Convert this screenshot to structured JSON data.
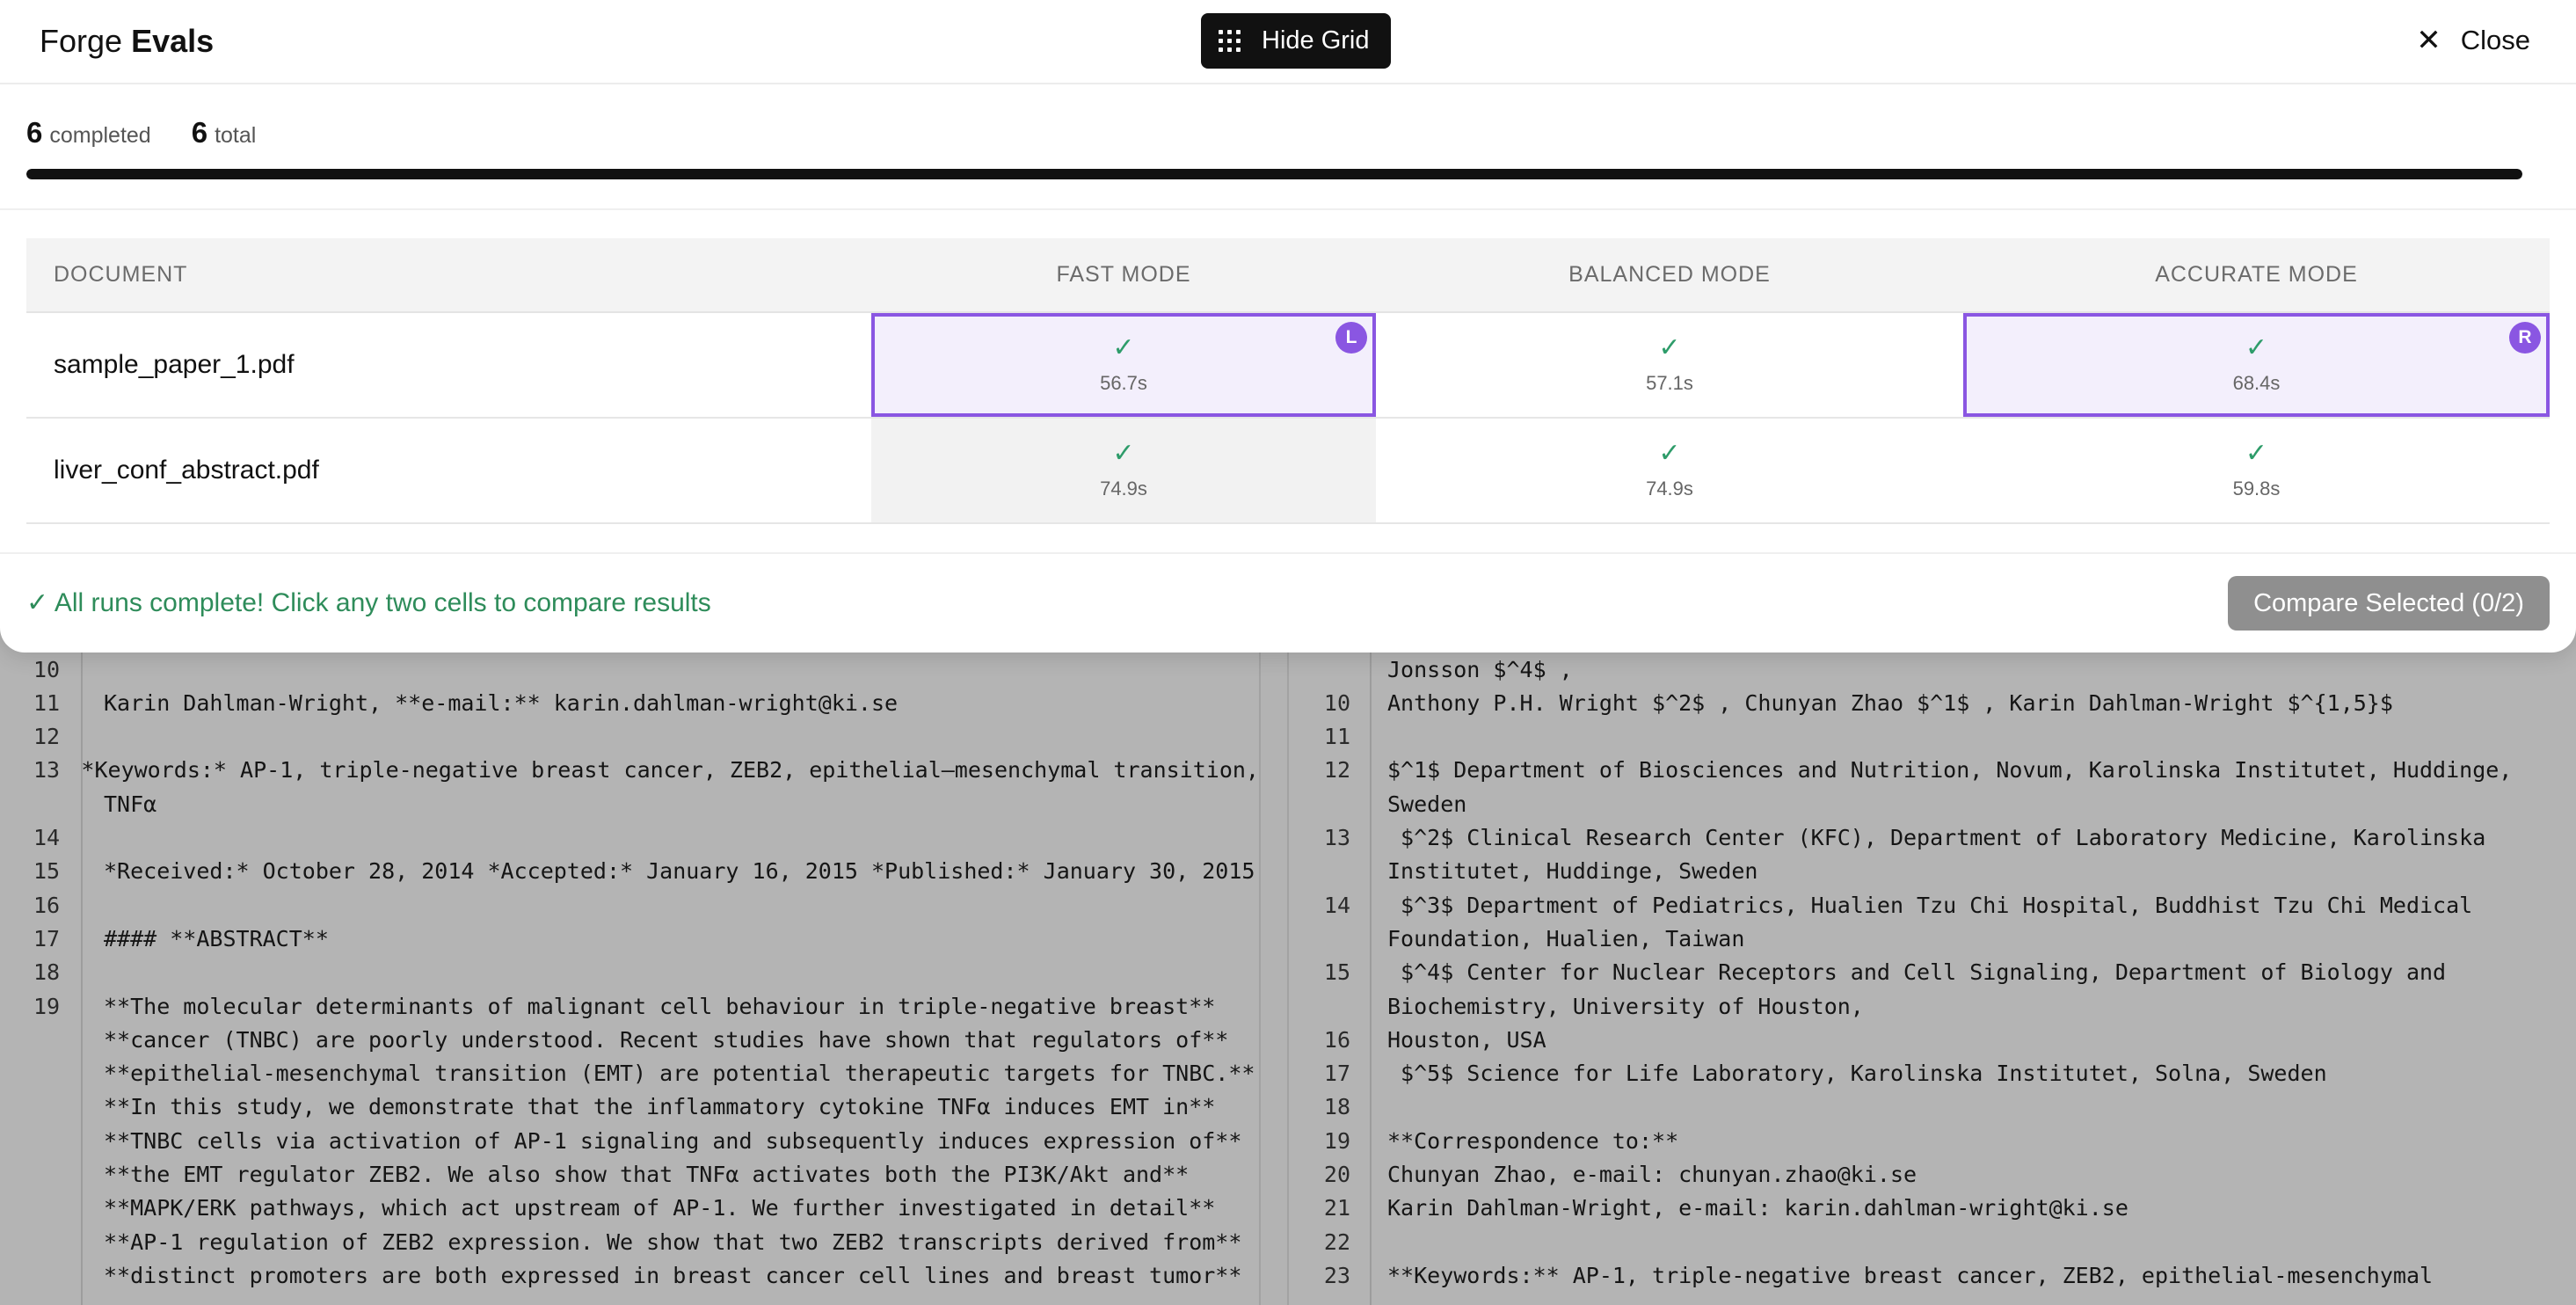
{
  "app": {
    "brand_light": "Forge",
    "brand_bold": "Evals"
  },
  "header": {
    "hide_grid_label": "Hide Grid",
    "close_label": "Close",
    "grid_icon": "grid-dots-icon",
    "close_icon": "close-icon"
  },
  "stats": {
    "completed_value": "6",
    "completed_label": "completed",
    "total_value": "6",
    "total_label": "total",
    "progress_fraction": 1.0
  },
  "table": {
    "headers": {
      "document": "DOCUMENT",
      "fast": "FAST MODE",
      "balanced": "BALANCED MODE",
      "accurate": "ACCURATE MODE"
    },
    "rows": [
      {
        "document": "sample_paper_1.pdf",
        "fast": "56.7s",
        "balanced": "57.1s",
        "accurate": "68.4s",
        "fast_badge": "L",
        "accurate_badge": "R"
      },
      {
        "document": "liver_conf_abstract.pdf",
        "fast": "74.9s",
        "balanced": "74.9s",
        "accurate": "59.8s"
      }
    ],
    "check_glyph": "✓"
  },
  "footer": {
    "status": "✓ All runs complete! Click any two cells to compare results",
    "compare_label": "Compare Selected (0/2)"
  },
  "diff": {
    "left": [
      {
        "n": "10",
        "t": ""
      },
      {
        "n": "11",
        "t": "Karin Dahlman-Wright, **e-mail:** karin.dahlman-wright@ki.se"
      },
      {
        "n": "12",
        "t": ""
      },
      {
        "n": "13",
        "t": "*Keywords:* AP-1, triple-negative breast cancer, ZEB2, epithelial–mesenchymal transition,"
      },
      {
        "n": "",
        "t": "TNFα"
      },
      {
        "n": "14",
        "t": ""
      },
      {
        "n": "15",
        "t": "*Received:* October 28, 2014 *Accepted:* January 16, 2015 *Published:* January 30, 2015"
      },
      {
        "n": "16",
        "t": ""
      },
      {
        "n": "17",
        "t": "#### **ABSTRACT**"
      },
      {
        "n": "18",
        "t": ""
      },
      {
        "n": "19",
        "t": "**The molecular determinants of malignant cell behaviour in triple-negative breast**"
      },
      {
        "n": "",
        "t": "**cancer (TNBC) are poorly understood. Recent studies have shown that regulators of**"
      },
      {
        "n": "",
        "t": "**epithelial-mesenchymal transition (EMT) are potential therapeutic targets for TNBC.**"
      },
      {
        "n": "",
        "t": "**In this study, we demonstrate that the inflammatory cytokine TNFα induces EMT in**"
      },
      {
        "n": "",
        "t": "**TNBC cells via activation of AP-1 signaling and subsequently induces expression of**"
      },
      {
        "n": "",
        "t": "**the EMT regulator ZEB2. We also show that TNFα activates both the PI3K/Akt and**"
      },
      {
        "n": "",
        "t": "**MAPK/ERK pathways, which act upstream of AP-1. We further investigated in detail**"
      },
      {
        "n": "",
        "t": "**AP-1 regulation of ZEB2 expression. We show that two ZEB2 transcripts derived from**"
      },
      {
        "n": "",
        "t": "**distinct promoters are both expressed in breast cancer cell lines and breast tumor**"
      }
    ],
    "right": [
      {
        "n": "",
        "t": "Jonsson $^4$ ,"
      },
      {
        "n": "10",
        "t": "Anthony P.H. Wright $^2$ , Chunyan Zhao $^1$ , Karin Dahlman-Wright $^{1,5}$"
      },
      {
        "n": "11",
        "t": ""
      },
      {
        "n": "12",
        "t": "$^1$ Department of Biosciences and Nutrition, Novum, Karolinska Institutet, Huddinge,"
      },
      {
        "n": "",
        "t": "Sweden"
      },
      {
        "n": "13",
        "t": " $^2$ Clinical Research Center (KFC), Department of Laboratory Medicine, Karolinska"
      },
      {
        "n": "",
        "t": "Institutet, Huddinge, Sweden"
      },
      {
        "n": "14",
        "t": " $^3$ Department of Pediatrics, Hualien Tzu Chi Hospital, Buddhist Tzu Chi Medical"
      },
      {
        "n": "",
        "t": "Foundation, Hualien, Taiwan"
      },
      {
        "n": "15",
        "t": " $^4$ Center for Nuclear Receptors and Cell Signaling, Department of Biology and"
      },
      {
        "n": "",
        "t": "Biochemistry, University of Houston,"
      },
      {
        "n": "16",
        "t": "Houston, USA"
      },
      {
        "n": "17",
        "t": " $^5$ Science for Life Laboratory, Karolinska Institutet, Solna, Sweden"
      },
      {
        "n": "18",
        "t": ""
      },
      {
        "n": "19",
        "t": "**Correspondence to:**"
      },
      {
        "n": "20",
        "t": "Chunyan Zhao, e-mail: chunyan.zhao@ki.se"
      },
      {
        "n": "21",
        "t": "Karin Dahlman-Wright, e-mail: karin.dahlman-wright@ki.se"
      },
      {
        "n": "22",
        "t": ""
      },
      {
        "n": "23",
        "t": "**Keywords:** AP-1, triple-negative breast cancer, ZEB2, epithelial-mesenchymal"
      }
    ]
  }
}
